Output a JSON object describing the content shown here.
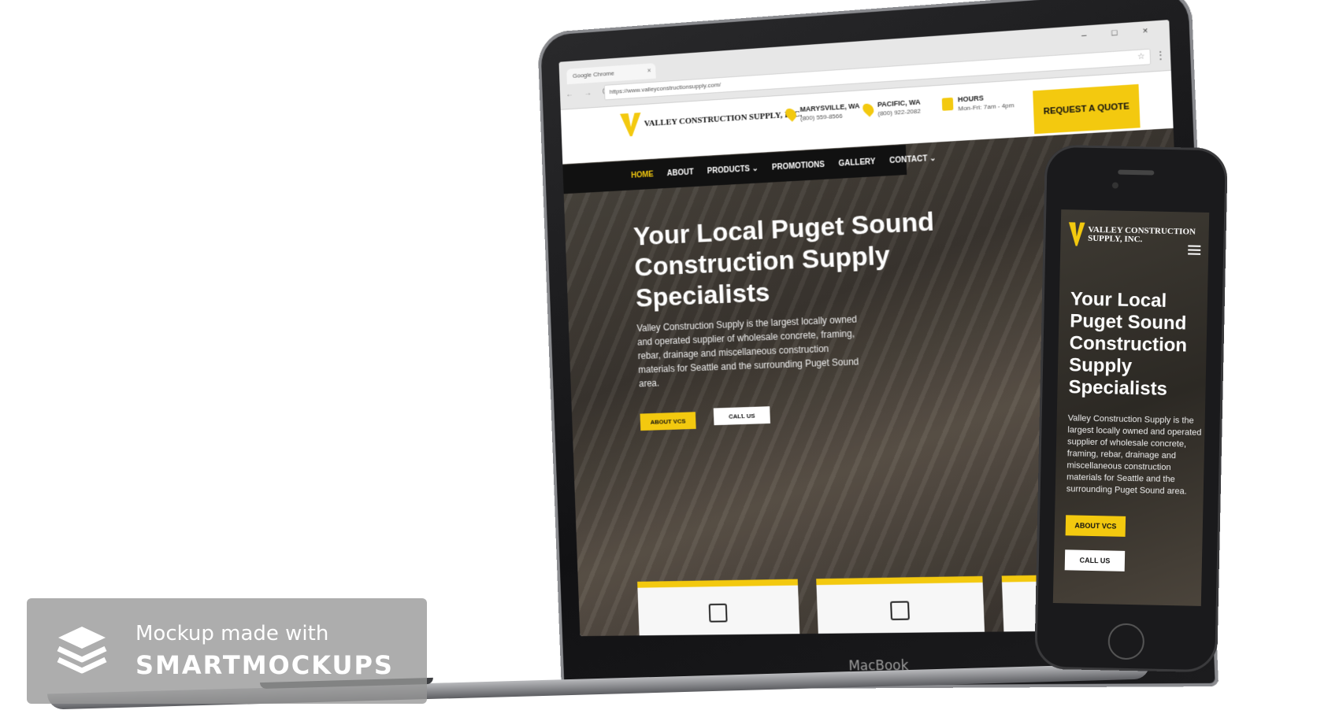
{
  "browser": {
    "tab_title": "Google Chrome",
    "tab_close": "×",
    "window_controls": "– □ ×",
    "nav_arrows": "← → C",
    "url": "https://www.valleyconstructionsupply.com/"
  },
  "site": {
    "logo": "VALLEY CONSTRUCTION SUPPLY, INC.",
    "locations": [
      {
        "title": "MARYSVILLE, WA",
        "sub": "(800) 559-8566"
      },
      {
        "title": "PACIFIC, WA",
        "sub": "(800) 922-2082"
      }
    ],
    "hours": {
      "title": "HOURS",
      "sub": "Mon-Fri: 7am - 4pm"
    },
    "quote_button": "REQUEST A QUOTE",
    "nav": [
      "HOME",
      "ABOUT",
      "PRODUCTS ⌄",
      "PROMOTIONS",
      "GALLERY",
      "CONTACT ⌄"
    ],
    "hero": {
      "title": "Your Local Puget Sound Construction Supply Specialists",
      "description": "Valley Construction Supply is the largest locally owned and operated supplier of wholesale concrete, framing, rebar, drainage and miscellaneous construction materials for Seattle and the surrounding Puget Sound area.",
      "about_button": "ABOUT VCS",
      "call_button": "CALL US"
    }
  },
  "device": {
    "laptop_brand": "MacBook"
  },
  "watermark": {
    "line1": "Mockup made with",
    "line2": "SMARTMOCKUPS"
  },
  "colors": {
    "accent": "#f3c90f",
    "dark": "#111111"
  }
}
